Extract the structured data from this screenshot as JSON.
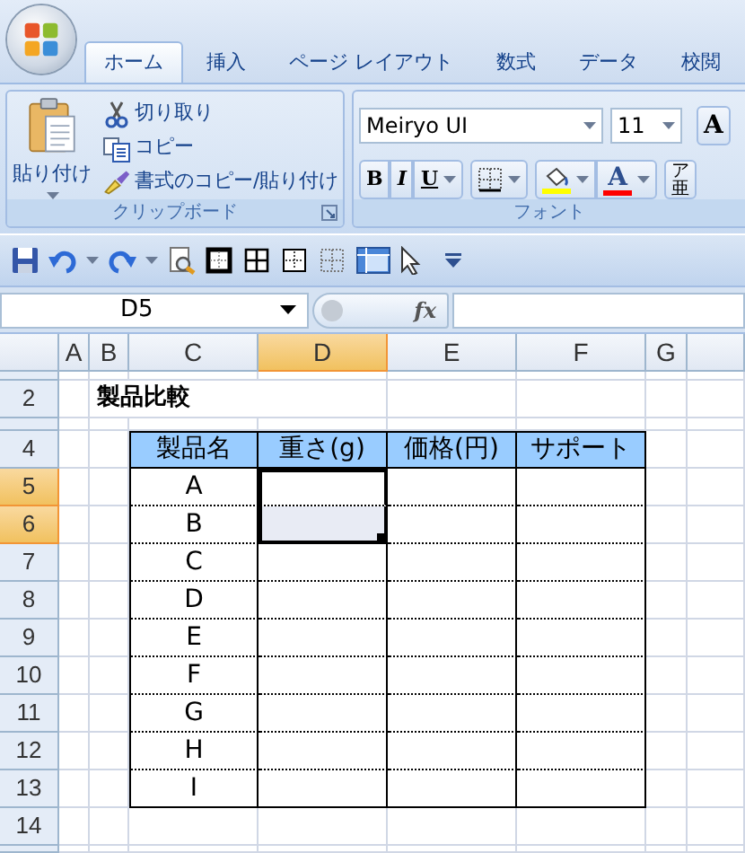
{
  "tabs": [
    {
      "label": "ホーム",
      "selected": true
    },
    {
      "label": "挿入",
      "selected": false
    },
    {
      "label": "ページ レイアウト",
      "selected": false
    },
    {
      "label": "数式",
      "selected": false
    },
    {
      "label": "データ",
      "selected": false
    },
    {
      "label": "校閲",
      "selected": false
    }
  ],
  "clipboard": {
    "paste": "貼り付け",
    "cut": "切り取り",
    "copy": "コピー",
    "format_painter": "書式のコピー/貼り付け",
    "label": "クリップボード"
  },
  "font": {
    "font_name": "Meiryo UI",
    "font_size": "11",
    "grow": "A",
    "bold": "B",
    "italic": "I",
    "underline": "U",
    "font_color": "A",
    "phonetic_top": "ア",
    "phonetic_bottom": "亜",
    "label": "フォント"
  },
  "name_box": "D5",
  "formula_button": "fx",
  "column_headers": [
    {
      "label": "A",
      "selected": false
    },
    {
      "label": "B",
      "selected": false
    },
    {
      "label": "C",
      "selected": false
    },
    {
      "label": "D",
      "selected": true
    },
    {
      "label": "E",
      "selected": false
    },
    {
      "label": "F",
      "selected": false
    },
    {
      "label": "G",
      "selected": false
    }
  ],
  "row_headers": [
    {
      "label": "2",
      "selected": false
    },
    {
      "label": "4",
      "selected": false
    },
    {
      "label": "5",
      "selected": true
    },
    {
      "label": "6",
      "selected": true
    },
    {
      "label": "7",
      "selected": false
    },
    {
      "label": "8",
      "selected": false
    },
    {
      "label": "9",
      "selected": false
    },
    {
      "label": "10",
      "selected": false
    },
    {
      "label": "11",
      "selected": false
    },
    {
      "label": "12",
      "selected": false
    },
    {
      "label": "13",
      "selected": false
    },
    {
      "label": "14",
      "selected": false
    }
  ],
  "sheet": {
    "title": "製品比較",
    "table": {
      "columns": [
        "製品名",
        "重さ(g)",
        "価格(円)",
        "サポート"
      ],
      "rows": [
        "A",
        "B",
        "C",
        "D",
        "E",
        "F",
        "G",
        "H",
        "I"
      ]
    }
  }
}
